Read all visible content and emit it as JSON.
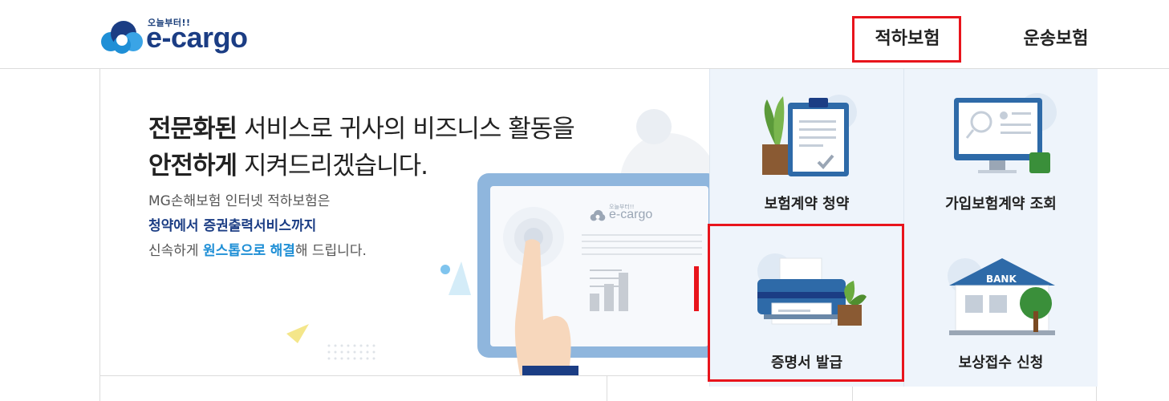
{
  "header": {
    "logo_tagline": "오늘부터!!",
    "logo_text": "e-cargo",
    "nav": [
      {
        "label": "적하보험",
        "highlighted": true
      },
      {
        "label": "운송보험",
        "highlighted": false
      }
    ]
  },
  "hero": {
    "title_line1_bold": "전문화된",
    "title_line1_rest": " 서비스로 귀사의 비즈니스 활동을",
    "title_line2_bold": "안전하게",
    "title_line2_rest": " 지켜드리겠습니다.",
    "desc_line1": "MG손해보험 인터넷 적하보험은",
    "desc_line2": "청약에서 증권출력서비스까지",
    "desc_line3_pre": "신속하게 ",
    "desc_line3_highlight1": "원스톱으로",
    "desc_line3_mid": " ",
    "desc_line3_highlight2": "해결",
    "desc_line3_post": "해 드립니다.",
    "monitor_logo_tagline": "오늘부터!!",
    "monitor_logo_text": "e-cargo"
  },
  "tiles": [
    {
      "label": "보험계약 청약",
      "icon": "clipboard-plant-icon",
      "highlighted": false
    },
    {
      "label": "가입보험계약 조회",
      "icon": "monitor-search-icon",
      "highlighted": false
    },
    {
      "label": "증명서 발급",
      "icon": "printer-icon",
      "highlighted": true
    },
    {
      "label": "보상접수 신청",
      "icon": "bank-building-icon",
      "highlighted": false
    }
  ],
  "illustration": {
    "bank_sign": "BANK"
  },
  "colors": {
    "brand_navy": "#1b3d84",
    "brand_blue": "#1f8fd6",
    "highlight_red": "#e8141c",
    "tile_bg": "#eef4fb"
  }
}
